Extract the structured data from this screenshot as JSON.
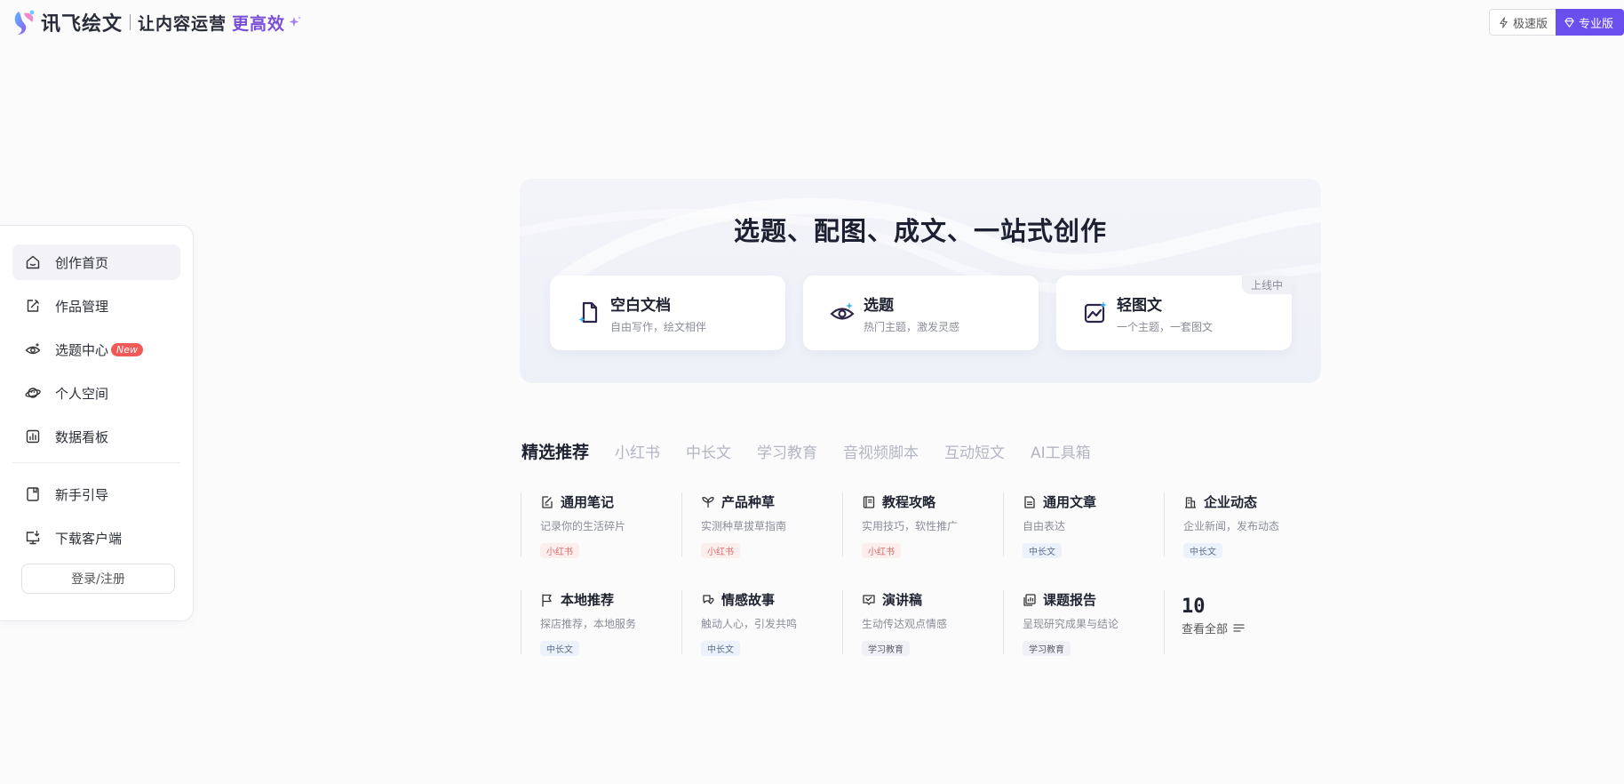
{
  "header": {
    "brand": "讯飞绘文",
    "slogan": "让内容运营",
    "slogan_highlight": "更高效",
    "edition_fast": "极速版",
    "edition_pro": "专业版",
    "accent_color": "#6b4fee"
  },
  "sidebar": {
    "items": [
      {
        "label": "创作首页",
        "icon": "home-icon",
        "active": true
      },
      {
        "label": "作品管理",
        "icon": "edit-icon"
      },
      {
        "label": "选题中心",
        "icon": "eye-icon",
        "badge": "New"
      },
      {
        "label": "个人空间",
        "icon": "planet-icon"
      },
      {
        "label": "数据看板",
        "icon": "chart-icon"
      }
    ],
    "secondary_items": [
      {
        "label": "新手引导",
        "icon": "guide-icon"
      },
      {
        "label": "下载客户端",
        "icon": "monitor-download-icon"
      }
    ],
    "login_label": "登录/注册"
  },
  "hero": {
    "title": "选题、配图、成文、一站式创作",
    "cards": [
      {
        "title": "空白文档",
        "desc": "自由写作，绘文相伴",
        "icon": "blank-doc-icon"
      },
      {
        "title": "选题",
        "desc": "热门主题，激发灵感",
        "icon": "eye-sparkle-icon"
      },
      {
        "title": "轻图文",
        "desc": "一个主题，一套图文",
        "icon": "image-text-icon",
        "tag": "上线中"
      }
    ]
  },
  "tabs": [
    "精选推荐",
    "小红书",
    "中长文",
    "学习教育",
    "音视频脚本",
    "互动短文",
    "AI工具箱"
  ],
  "tiles": [
    {
      "title": "通用笔记",
      "desc": "记录你的生活碎片",
      "tag": "小红书",
      "icon": "note-icon"
    },
    {
      "title": "产品种草",
      "desc": "实测种草拔草指南",
      "tag": "小红书",
      "icon": "sprout-icon"
    },
    {
      "title": "教程攻略",
      "desc": "实用技巧，软性推广",
      "tag": "小红书",
      "icon": "book-icon"
    },
    {
      "title": "通用文章",
      "desc": "自由表达",
      "tag": "中长文",
      "icon": "article-icon"
    },
    {
      "title": "企业动态",
      "desc": "企业新闻，发布动态",
      "tag": "中长文",
      "icon": "building-icon"
    },
    {
      "title": "本地推荐",
      "desc": "探店推荐，本地服务",
      "tag": "中长文",
      "icon": "flag-icon"
    },
    {
      "title": "情感故事",
      "desc": "触动人心，引发共鸣",
      "tag": "中长文",
      "icon": "heart-chat-icon"
    },
    {
      "title": "演讲稿",
      "desc": "生动传达观点情感",
      "tag": "学习教育",
      "icon": "speech-icon"
    },
    {
      "title": "课题报告",
      "desc": "呈现研究成果与结论",
      "tag": "学习教育",
      "icon": "report-icon"
    }
  ],
  "more": {
    "count": "10",
    "label": "查看全部"
  }
}
